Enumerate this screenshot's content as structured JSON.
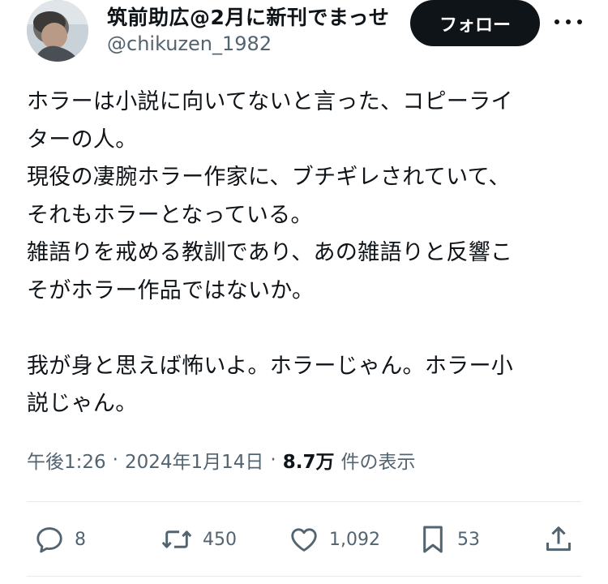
{
  "author": {
    "display_name": "筑前助広@2月に新刊でまっせ",
    "handle": "@chikuzen_1982"
  },
  "follow_label": "フォロー",
  "tweet": {
    "text": "ホラーは小説に向いてないと言った、コピーライ\nターの人。\n現役の凄腕ホラー作家に、ブチギレされていて、\nそれもホラーとなっている。\n雑語りを戒める教訓であり、あの雑語りと反響こ\nそがホラー作品ではないか。\n\n我が身と思えば怖いよ。ホラーじゃん。ホラー小\n説じゃん。"
  },
  "meta": {
    "time": "午後1:26",
    "separator": "·",
    "date": "2024年1月14日",
    "views": "8.7万",
    "views_label": "件の表示"
  },
  "actions": {
    "replies": "8",
    "reposts": "450",
    "likes": "1,092",
    "bookmarks": "53"
  },
  "icons": [
    "more-icon",
    "reply-icon",
    "repost-icon",
    "like-icon",
    "bookmark-icon",
    "share-icon"
  ],
  "colors": {
    "text": "#0f1419",
    "secondary": "#536471",
    "button": "#0f1419",
    "divider": "#e7e9ea"
  }
}
